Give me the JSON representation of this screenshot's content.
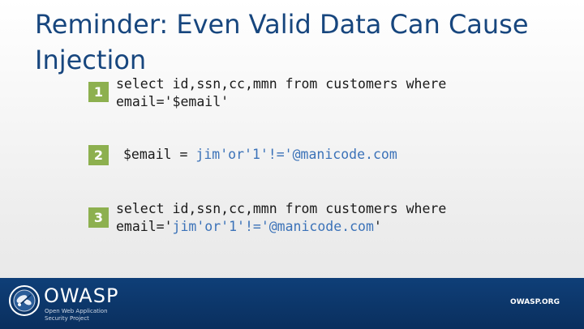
{
  "slide": {
    "title": "Reminder: Even Valid Data Can Cause Injection"
  },
  "steps": [
    {
      "badge": "1",
      "line1": "select id,ssn,cc,mmn from customers where",
      "line2": "email='$email'"
    },
    {
      "badge": "2",
      "prefix": "$email = ",
      "value": "jim'or'1'!='@manicode.com"
    },
    {
      "badge": "3",
      "line1": "select id,ssn,cc,mmn from customers where",
      "line2_prefix": "email='",
      "line2_value": "jim'or'1'!='@manicode.com",
      "line2_suffix": "'"
    }
  ],
  "footer": {
    "logo_icon": "owasp-wasp-logo-icon",
    "logo_text": "OWASP",
    "tagline_line1": "Open Web Application",
    "tagline_line2": "Security Project",
    "url": "OWASP.ORG"
  },
  "colors": {
    "title": "#17467e",
    "badge": "#8db04f",
    "highlight": "#3b72b8",
    "footer": "#0f3f78"
  }
}
